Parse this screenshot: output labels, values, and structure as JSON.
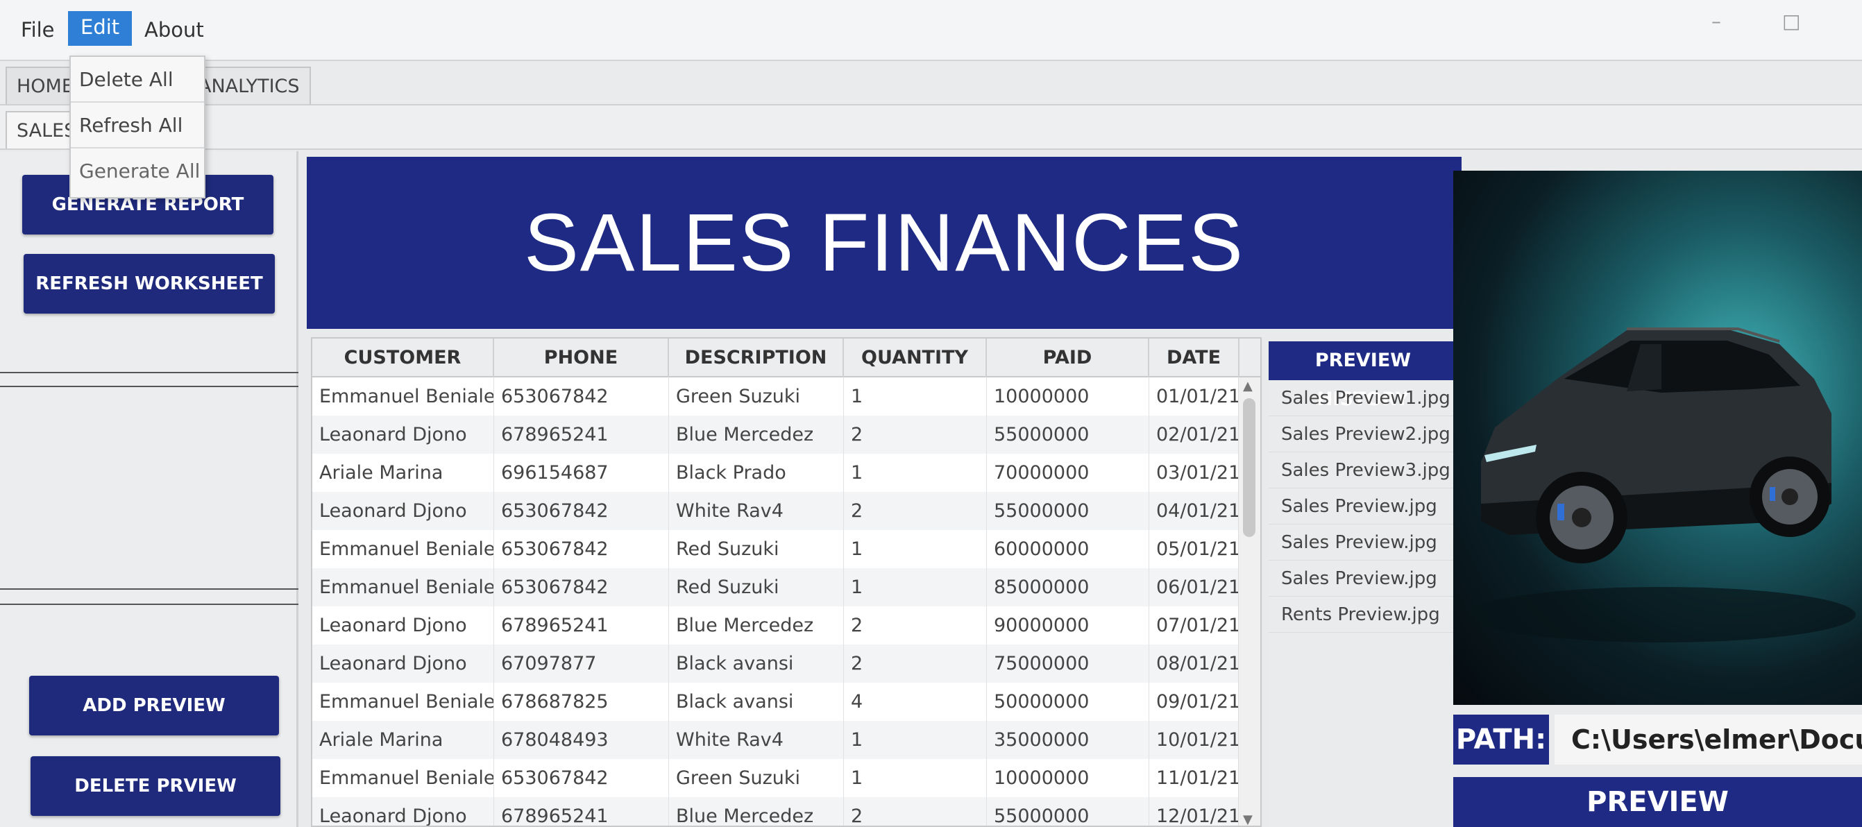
{
  "menubar": {
    "items": [
      "File",
      "Edit",
      "About"
    ],
    "active": "Edit",
    "window_controls": [
      "–",
      "□"
    ]
  },
  "edit_menu": {
    "items": [
      "Delete All",
      "Refresh All",
      "Generate All"
    ]
  },
  "tabs": {
    "row1": [
      "HOME",
      "ANALYTICS"
    ],
    "row2": [
      "SALES"
    ]
  },
  "left_panel": {
    "generate_report": "GENERATE REPORT",
    "refresh_worksheet": "REFRESH WORKSHEET",
    "add_preview": "ADD PREVIEW",
    "delete_preview": "DELETE PRVIEW"
  },
  "banner": {
    "title": "SALES FINANCES"
  },
  "table": {
    "columns": [
      "CUSTOMER",
      "PHONE",
      "DESCRIPTION",
      "QUANTITY",
      "PAID",
      "DATE"
    ],
    "rows": [
      [
        "Emmanuel Beniale",
        "653067842",
        "Green Suzuki",
        "1",
        "10000000",
        "01/01/21"
      ],
      [
        "Leaonard Djono",
        "678965241",
        "Blue Mercedez",
        "2",
        "55000000",
        "02/01/21"
      ],
      [
        "Ariale Marina",
        "696154687",
        "Black Prado",
        "1",
        "70000000",
        "03/01/21"
      ],
      [
        "Leaonard Djono",
        "653067842",
        "White Rav4",
        "2",
        "55000000",
        "04/01/21"
      ],
      [
        "Emmanuel Beniale",
        "653067842",
        "Red Suzuki",
        "1",
        "60000000",
        "05/01/21"
      ],
      [
        "Emmanuel Beniale",
        "653067842",
        "Red Suzuki",
        "1",
        "85000000",
        "06/01/21"
      ],
      [
        "Leaonard Djono",
        "678965241",
        "Blue Mercedez",
        "2",
        "90000000",
        "07/01/21"
      ],
      [
        "Leaonard Djono",
        "67097877",
        "Black avansi",
        "2",
        "75000000",
        "08/01/21"
      ],
      [
        "Emmanuel Beniale",
        "678687825",
        "Black avansi",
        "4",
        "50000000",
        "09/01/21"
      ],
      [
        "Ariale Marina",
        "678048493",
        "White Rav4",
        "1",
        "35000000",
        "10/01/21"
      ],
      [
        "Emmanuel Beniale",
        "653067842",
        "Green Suzuki",
        "1",
        "10000000",
        "11/01/21"
      ],
      [
        "Leaonard Djono",
        "678965241",
        "Blue Mercedez",
        "2",
        "55000000",
        "12/01/21"
      ]
    ]
  },
  "preview_history": {
    "title": "PREVIEW HISTORY",
    "items": [
      "Sales Preview1.jpg",
      "Sales Preview2.jpg",
      "Sales Preview3.jpg",
      "Sales Preview.jpg",
      "Sales Preview.jpg",
      "Sales Preview.jpg",
      "Rents Preview.jpg"
    ]
  },
  "path": {
    "label": "PATH:",
    "value": "C:\\Users\\elmer\\Docu"
  },
  "preview_button": "PREVIEW",
  "colors": {
    "navy": "#1e2a83",
    "menu_highlight": "#2f7fd6"
  }
}
